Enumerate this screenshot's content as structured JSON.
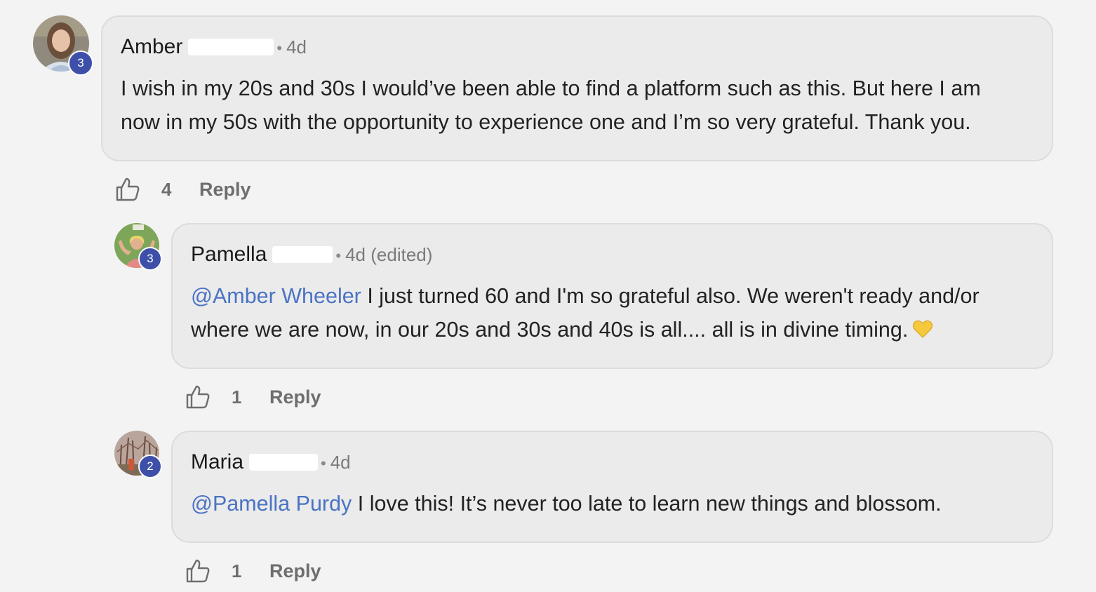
{
  "comments": [
    {
      "author": "Amber",
      "time": "4d",
      "level": "3",
      "body_lines": [
        "I wish in my 20s and 30s I would’ve been able to find a platform such as this. But here I am",
        "now in my 50s with the opportunity to experience one and I’m so very grateful. Thank you."
      ],
      "likes": "4",
      "reply_label": "Reply",
      "avatar_icon": "avatar-woman-icon"
    },
    {
      "author": "Pamella",
      "time": "4d (edited)",
      "level": "3",
      "mention": "@Amber Wheeler",
      "body_line1": " I just turned 60 and I'm so grateful also. We weren't ready and/or",
      "body_line2": "where we are now, in our 20s and 30s and 40s is all.... all is in divine timing.",
      "emoji": "yellow-heart-icon",
      "likes": "1",
      "reply_label": "Reply"
    },
    {
      "author": "Maria",
      "time": "4d",
      "level": "2",
      "mention": "@Pamella Purdy",
      "body_line1": " I love this! It’s never too late to learn new things and blossom.",
      "likes": "1",
      "reply_label": "Reply"
    }
  ],
  "colors": {
    "background": "#f3f3f3",
    "bubble": "#ebebeb",
    "mention": "#4a73c4",
    "level_badge": "#3d4fa8",
    "muted_text": "#6e6e6e"
  }
}
